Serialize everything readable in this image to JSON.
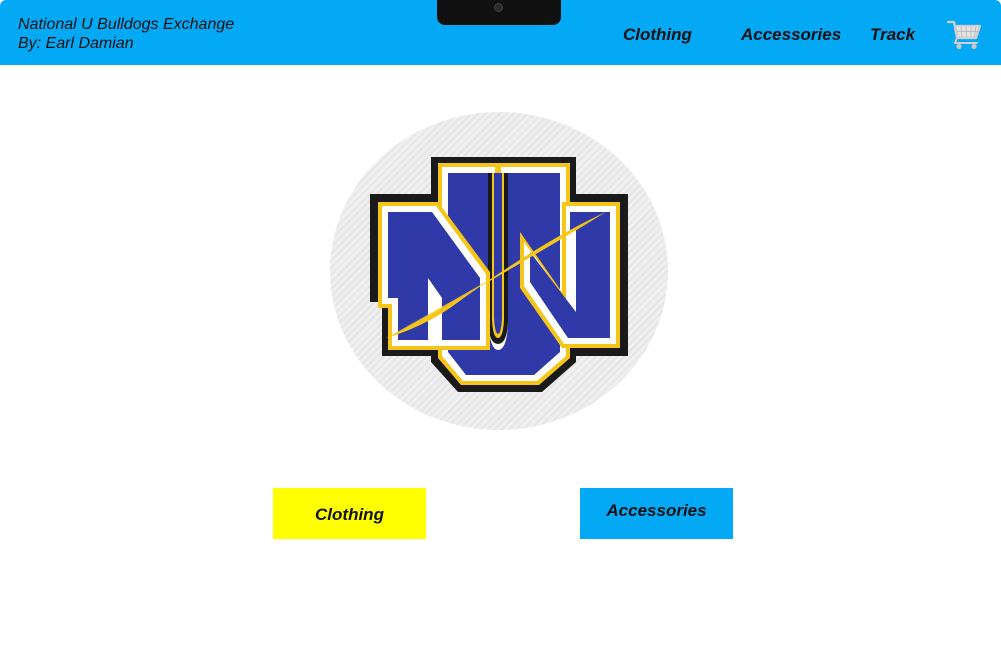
{
  "header": {
    "brand_title": "National U Bulldogs Exchange",
    "brand_author": "By: Earl Damian",
    "background_color": "#03a9f4",
    "nav": {
      "clothing": "Clothing",
      "accessories": "Accessories",
      "track": "Track"
    },
    "cart_icon": "shopping-cart-icon"
  },
  "hero": {
    "logo_icon": "nu-bulldogs-logo",
    "logo_colors": {
      "blue": "#2f3aa8",
      "gold": "#f5c518",
      "black": "#1a1a1a"
    }
  },
  "buttons": {
    "clothing": {
      "label": "Clothing",
      "color": "#ffff00"
    },
    "accessories": {
      "label": "Accessories",
      "color": "#03a9f4"
    }
  }
}
